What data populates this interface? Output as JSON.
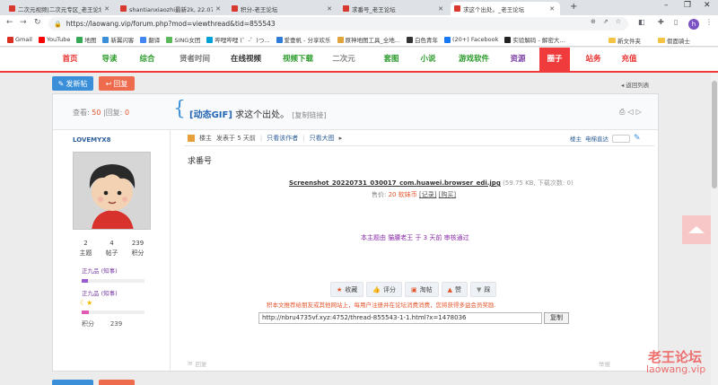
{
  "browser": {
    "tabs": [
      {
        "title": "二次元视频|二次元专区_老王论坛",
        "active": false
      },
      {
        "title": "shantianxiaozhi最新2k, 22.07",
        "active": false
      },
      {
        "title": "积分-老王论坛",
        "active": false
      },
      {
        "title": "求番号_老王论坛",
        "active": false
      },
      {
        "title": "求这个出处。_老王论坛",
        "active": true
      }
    ],
    "new_tab": "+",
    "url": "https://laowang.vip/forum.php?mod=viewthread&tid=855543",
    "profile_initial": "h",
    "bookmarks": [
      {
        "label": "Gmail",
        "color": "#d93025"
      },
      {
        "label": "YouTube",
        "color": "#ff0000"
      },
      {
        "label": "地图",
        "color": "#34a853"
      },
      {
        "label": "新翼闪客",
        "color": "#3b8fd8"
      },
      {
        "label": "翻译",
        "color": "#4285f4"
      },
      {
        "label": "SING女团",
        "color": "#5cb85c"
      },
      {
        "label": "哔哩哔哩 (゜-゜)つ...",
        "color": "#00a1d6"
      },
      {
        "label": "爱壹帆 - 分享欢乐",
        "color": "#2f7bd8"
      },
      {
        "label": "原神地图工具_全地...",
        "color": "#e0a43a"
      },
      {
        "label": "白色青年",
        "color": "#333333"
      },
      {
        "label": "(20+) Facebook",
        "color": "#1877f2"
      },
      {
        "label": "实验解码 - 解密大...",
        "color": "#222222"
      }
    ],
    "bookmark_folders": [
      "新文件夹",
      "假面骑士"
    ]
  },
  "site_nav": [
    {
      "label": "首页",
      "color": "#e8302e",
      "active": false
    },
    {
      "label": "导读",
      "color": "#2c9b2c",
      "active": false
    },
    {
      "label": "综合",
      "color": "#2c9b2c",
      "active": false
    },
    {
      "label": "贤者时间",
      "color": "#777777",
      "active": false
    },
    {
      "label": "在线视频",
      "color": "#333333",
      "active": false
    },
    {
      "label": "视频下载",
      "color": "#2c9b2c",
      "active": false
    },
    {
      "label": "二次元",
      "color": "#888888",
      "active": false
    },
    {
      "label": "套图",
      "color": "#2c9b2c",
      "active": false
    },
    {
      "label": "小说",
      "color": "#2c9b2c",
      "active": false
    },
    {
      "label": "游戏软件",
      "color": "#2c9b2c",
      "active": false
    },
    {
      "label": "资源",
      "color": "#7b3fa5",
      "active": false
    },
    {
      "label": "圈子",
      "color": "#ffffff",
      "active": true
    },
    {
      "label": "站务",
      "color": "#e8302e",
      "active": false
    },
    {
      "label": "充值",
      "color": "#e8302e",
      "active": false
    }
  ],
  "buttons": {
    "new_post": "发新帖",
    "reply": "回复",
    "back_to_list": "返回列表"
  },
  "thread": {
    "views_label": "查看:",
    "views": "50",
    "sep": "|",
    "replies_label": "回复:",
    "replies": "0",
    "tag": "[动态GIF]",
    "title": "求这个出处。",
    "copy_link": "[复制链接]"
  },
  "user": {
    "name": "LOVEMYX8",
    "stats": [
      {
        "value": "2",
        "label": "主题"
      },
      {
        "value": "4",
        "label": "帖子"
      },
      {
        "value": "239",
        "label": "积分"
      }
    ],
    "rank1": "正九品 (知事)",
    "rank2": "正九品 (知事)",
    "points_label": "积分",
    "points": "239"
  },
  "post": {
    "author_label": "楼主",
    "posted": "发表于 5 天前",
    "only_author": "只看该作者",
    "only_big": "只看大图",
    "floor_label": "楼主",
    "floor_jump": "电梯直达",
    "content": "求番号",
    "attachment_name": "Screenshot_20220731_030017_com.huawei.browser_edi.jpg",
    "attachment_meta": "(59.75 KB, 下载次数: 0)",
    "price_label": "售价:",
    "price_value": "20 软妹币",
    "record": "[记录]",
    "buy": "[购买]",
    "moderation": "本主题由 猫腰老王 于 3 天前 审核通过",
    "actions": [
      {
        "label": "收藏",
        "icon": "star-icon"
      },
      {
        "label": "评分",
        "icon": "thumbs-icon"
      },
      {
        "label": "淘帖",
        "icon": "basket-icon"
      },
      {
        "label": "赞",
        "icon": "up-arrow-icon"
      },
      {
        "label": "踩",
        "icon": "down-arrow-icon"
      }
    ],
    "warning": "积本文推荐给朋友或其他网站上，每用户注册并在论坛消费消费，您将获得多益会员奖励.",
    "share_url": "http://nbru4735vf.xyz:4752/thread-855543-1-1.html?x=1478036",
    "copy_btn": "复制",
    "reply_link": "回复",
    "report_link": "举报"
  },
  "watermark": {
    "line1": "老王论坛",
    "line2": "laowang.vip"
  }
}
